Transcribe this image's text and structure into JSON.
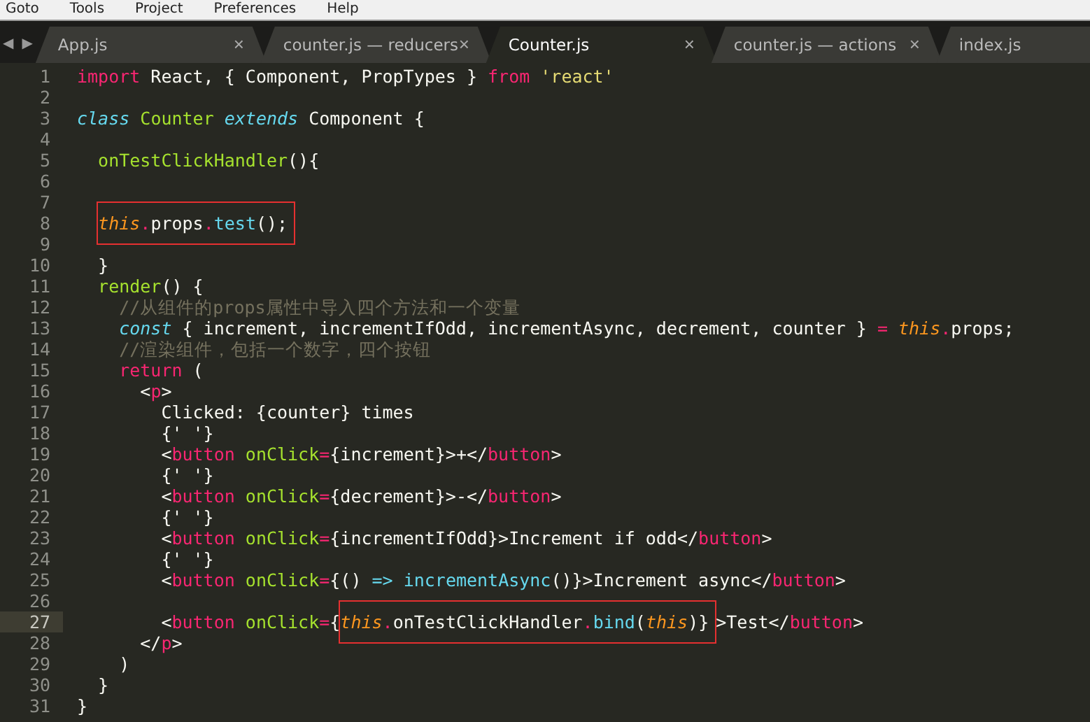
{
  "menu": [
    "Goto",
    "Tools",
    "Project",
    "Preferences",
    "Help"
  ],
  "tab_nav": [
    "◀",
    "▶"
  ],
  "tabs": [
    {
      "label": "App.js",
      "close": "×",
      "selected": false
    },
    {
      "label": "counter.js — reducers",
      "close": "×",
      "selected": false
    },
    {
      "label": "Counter.js",
      "close": "×",
      "selected": true
    },
    {
      "label": "counter.js — actions",
      "close": "×",
      "selected": false
    },
    {
      "label": "index.js",
      "selected": false
    }
  ],
  "lines": [
    {
      "number": "1",
      "current": false,
      "tokens": [
        {
          "kind": "keyword",
          "text": "import"
        },
        {
          "kind": "plain",
          "text": " React, { Component, PropTypes } "
        },
        {
          "kind": "keyword",
          "text": "from"
        },
        {
          "kind": "string",
          "text": " 'react'"
        }
      ]
    },
    {
      "number": "2",
      "current": false
    },
    {
      "number": "3",
      "current": false,
      "tokens": [
        {
          "kind": "storage",
          "text": "class"
        },
        {
          "kind": "entity",
          "text": " Counter"
        },
        {
          "kind": "storage",
          "text": " extends"
        },
        {
          "kind": "plain",
          "text": " Component {"
        }
      ]
    },
    {
      "number": "4",
      "current": false
    },
    {
      "number": "5",
      "current": false,
      "tokens": [
        {
          "kind": "entity",
          "text": "  onTestClickHandler"
        },
        {
          "kind": "plain",
          "text": "(){"
        }
      ]
    },
    {
      "number": "6",
      "current": false
    },
    {
      "number": "7",
      "current": false
    },
    {
      "number": "8",
      "current": false,
      "segments": [
        {
          "boxed": true,
          "tokens": [
            {
              "kind": "this",
              "text": "  this"
            },
            {
              "kind": "keyword",
              "text": "."
            },
            {
              "kind": "plain",
              "text": "props"
            },
            {
              "kind": "keyword",
              "text": "."
            },
            {
              "kind": "function",
              "text": "test"
            },
            {
              "kind": "plain",
              "text": "();"
            }
          ]
        }
      ]
    },
    {
      "number": "9",
      "current": false
    },
    {
      "number": "10",
      "current": false,
      "tokens": [
        {
          "kind": "plain",
          "text": "  }"
        }
      ]
    },
    {
      "number": "11",
      "current": false,
      "tokens": [
        {
          "kind": "entity",
          "text": "  render"
        },
        {
          "kind": "plain",
          "text": "() {"
        }
      ]
    },
    {
      "number": "12",
      "current": false,
      "tokens": [
        {
          "kind": "comment",
          "text": "    //从组件的props属性中导入四个方法和一个变量"
        }
      ]
    },
    {
      "number": "13",
      "current": false,
      "tokens": [
        {
          "kind": "storage",
          "text": "    const"
        },
        {
          "kind": "plain",
          "text": " { increment, incrementIfOdd, incrementAsync, decrement, counter } "
        },
        {
          "kind": "keyword",
          "text": "="
        },
        {
          "kind": "this",
          "text": " this"
        },
        {
          "kind": "keyword",
          "text": "."
        },
        {
          "kind": "plain",
          "text": "props;"
        }
      ]
    },
    {
      "number": "14",
      "current": false,
      "tokens": [
        {
          "kind": "comment",
          "text": "    //渲染组件，包括一个数字，四个按钮"
        }
      ]
    },
    {
      "number": "15",
      "current": false,
      "tokens": [
        {
          "kind": "keyword",
          "text": "    return"
        },
        {
          "kind": "plain",
          "text": " ("
        }
      ]
    },
    {
      "number": "16",
      "current": false,
      "tokens": [
        {
          "kind": "plain",
          "text": "      <"
        },
        {
          "kind": "keyword",
          "text": "p"
        },
        {
          "kind": "plain",
          "text": ">"
        }
      ]
    },
    {
      "number": "17",
      "current": false,
      "tokens": [
        {
          "kind": "plain",
          "text": "        Clicked: {counter} times"
        }
      ]
    },
    {
      "number": "18",
      "current": false,
      "tokens": [
        {
          "kind": "plain",
          "text": "        {' '}"
        }
      ]
    },
    {
      "number": "19",
      "current": false,
      "tokens": [
        {
          "kind": "plain",
          "text": "        <"
        },
        {
          "kind": "keyword",
          "text": "button"
        },
        {
          "kind": "entity",
          "text": " onClick"
        },
        {
          "kind": "keyword",
          "text": "="
        },
        {
          "kind": "plain",
          "text": "{increment}>+</"
        },
        {
          "kind": "keyword",
          "text": "button"
        },
        {
          "kind": "plain",
          "text": ">"
        }
      ]
    },
    {
      "number": "20",
      "current": false,
      "tokens": [
        {
          "kind": "plain",
          "text": "        {' '}"
        }
      ]
    },
    {
      "number": "21",
      "current": false,
      "tokens": [
        {
          "kind": "plain",
          "text": "        <"
        },
        {
          "kind": "keyword",
          "text": "button"
        },
        {
          "kind": "entity",
          "text": " onClick"
        },
        {
          "kind": "keyword",
          "text": "="
        },
        {
          "kind": "plain",
          "text": "{decrement}>-</"
        },
        {
          "kind": "keyword",
          "text": "button"
        },
        {
          "kind": "plain",
          "text": ">"
        }
      ]
    },
    {
      "number": "22",
      "current": false,
      "tokens": [
        {
          "kind": "plain",
          "text": "        {' '}"
        }
      ]
    },
    {
      "number": "23",
      "current": false,
      "tokens": [
        {
          "kind": "plain",
          "text": "        <"
        },
        {
          "kind": "keyword",
          "text": "button"
        },
        {
          "kind": "entity",
          "text": " onClick"
        },
        {
          "kind": "keyword",
          "text": "="
        },
        {
          "kind": "plain",
          "text": "{incrementIfOdd}>Increment if odd</"
        },
        {
          "kind": "keyword",
          "text": "button"
        },
        {
          "kind": "plain",
          "text": ">"
        }
      ]
    },
    {
      "number": "24",
      "current": false,
      "tokens": [
        {
          "kind": "plain",
          "text": "        {' '}"
        }
      ]
    },
    {
      "number": "25",
      "current": false,
      "tokens": [
        {
          "kind": "plain",
          "text": "        <"
        },
        {
          "kind": "keyword",
          "text": "button"
        },
        {
          "kind": "entity",
          "text": " onClick"
        },
        {
          "kind": "keyword",
          "text": "="
        },
        {
          "kind": "plain",
          "text": "{() "
        },
        {
          "kind": "storage",
          "text": "=>"
        },
        {
          "kind": "function",
          "text": " incrementAsync"
        },
        {
          "kind": "plain",
          "text": "()}>Increment async</"
        },
        {
          "kind": "keyword",
          "text": "button"
        },
        {
          "kind": "plain",
          "text": ">"
        }
      ]
    },
    {
      "number": "26",
      "current": false
    },
    {
      "number": "27",
      "current": true,
      "segments": [
        {
          "boxed": false,
          "tokens": [
            {
              "kind": "plain",
              "text": "        <"
            },
            {
              "kind": "keyword",
              "text": "button"
            },
            {
              "kind": "entity",
              "text": " onClick"
            },
            {
              "kind": "keyword",
              "text": "="
            },
            {
              "kind": "plain",
              "text": "{"
            }
          ]
        },
        {
          "boxed": true,
          "tokens": [
            {
              "kind": "this",
              "text": "this"
            },
            {
              "kind": "keyword",
              "text": "."
            },
            {
              "kind": "plain",
              "text": "onTestClickHandler"
            },
            {
              "kind": "keyword",
              "text": "."
            },
            {
              "kind": "function",
              "text": "bind"
            },
            {
              "kind": "plain",
              "text": "("
            },
            {
              "kind": "this",
              "text": "this"
            },
            {
              "kind": "plain",
              "text": ")}"
            }
          ]
        },
        {
          "boxed": false,
          "tokens": [
            {
              "kind": "plain",
              "text": ">Test</"
            },
            {
              "kind": "keyword",
              "text": "button"
            },
            {
              "kind": "plain",
              "text": ">"
            }
          ]
        }
      ]
    },
    {
      "number": "28",
      "current": false,
      "tokens": [
        {
          "kind": "plain",
          "text": "      </"
        },
        {
          "kind": "keyword",
          "text": "p"
        },
        {
          "kind": "plain",
          "text": ">"
        }
      ]
    },
    {
      "number": "29",
      "current": false,
      "tokens": [
        {
          "kind": "plain",
          "text": "    )"
        }
      ]
    },
    {
      "number": "30",
      "current": false,
      "tokens": [
        {
          "kind": "plain",
          "text": "  }"
        }
      ]
    },
    {
      "number": "31",
      "current": false,
      "tokens": [
        {
          "kind": "plain",
          "text": "}"
        }
      ]
    }
  ]
}
